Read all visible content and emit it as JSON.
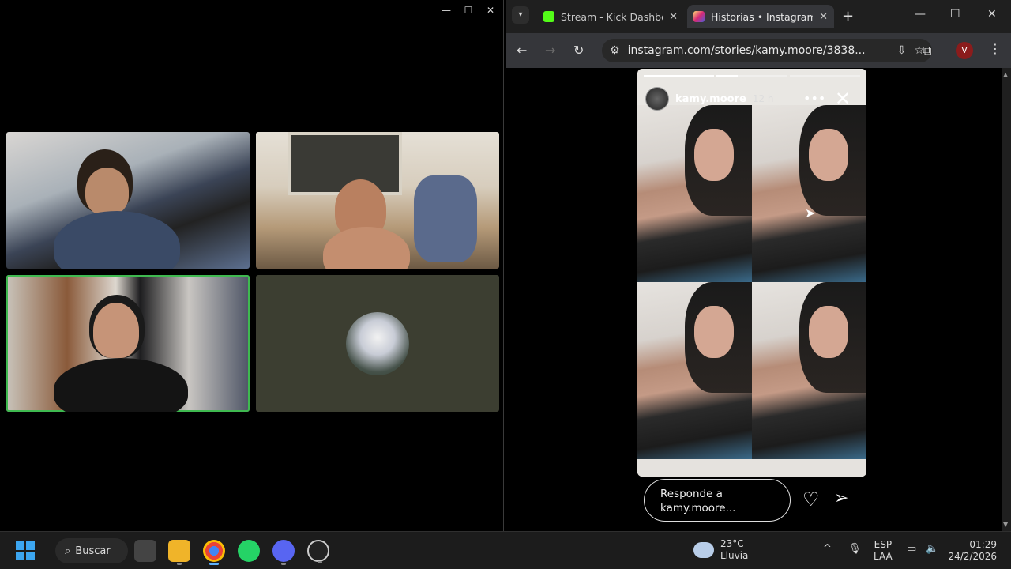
{
  "browser": {
    "tabs": [
      {
        "title": "Stream - Kick Dashboa",
        "icon": "kick-icon",
        "color": "#53fc18"
      },
      {
        "title": "Historias • Instagram",
        "icon": "instagram-icon",
        "color": "#e1306c"
      }
    ],
    "url": "instagram.com/stories/kamy.moore/3838...",
    "profile_initial": "V"
  },
  "story": {
    "username": "kamy.moore",
    "time": "12 h",
    "progress": [
      1.0,
      0.3,
      0.0
    ],
    "reply_placeholder": "Responde a kamy.moore..."
  },
  "taskbar": {
    "search_label": "Buscar",
    "weather_temp": "23°C",
    "weather_desc": "Lluvia",
    "lang_1": "ESP",
    "lang_2": "LAA",
    "time": "01:29",
    "date": "24/2/2026"
  }
}
